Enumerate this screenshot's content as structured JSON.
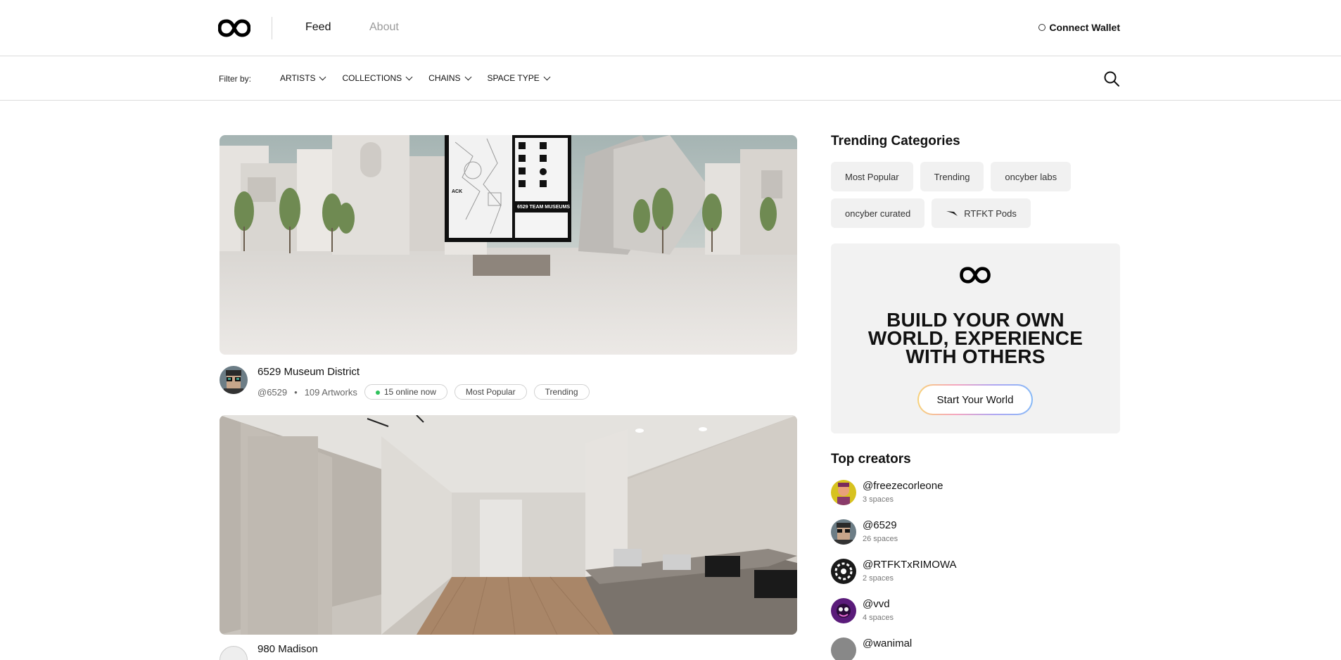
{
  "nav": {
    "feed": "Feed",
    "about": "About",
    "wallet": "Connect Wallet"
  },
  "filter": {
    "label": "Filter by:",
    "items": [
      {
        "label": "ARTISTS"
      },
      {
        "label": "COLLECTIONS"
      },
      {
        "label": "CHAINS"
      },
      {
        "label": "SPACE TYPE"
      }
    ]
  },
  "feed": [
    {
      "title": "6529 Museum District",
      "handle": "@6529",
      "artworks": "109 Artworks",
      "online": "15 online now",
      "tags": [
        "Most Popular",
        "Trending"
      ],
      "billboard_text": "6529 TEAM MUSEUMS",
      "billboard_label": "ACK"
    },
    {
      "title": "980 Madison"
    }
  ],
  "sidebar": {
    "trending_title": "Trending Categories",
    "categories": [
      {
        "label": "Most Popular"
      },
      {
        "label": "Trending"
      },
      {
        "label": "oncyber labs"
      },
      {
        "label": "oncyber curated"
      },
      {
        "label": "RTFKT Pods",
        "icon": "rtfkt-icon"
      }
    ],
    "promo": {
      "heading_line1": "BUILD YOUR OWN",
      "heading_line2": "WORLD, EXPERIENCE",
      "heading_line3": "WITH OTHERS",
      "button": "Start Your World"
    },
    "creators_title": "Top creators",
    "creators": [
      {
        "name": "@freezecorleone",
        "spaces": "3 spaces",
        "color": "#d7c21f"
      },
      {
        "name": "@6529",
        "spaces": "26 spaces",
        "color": "#3c4a52"
      },
      {
        "name": "@RTFKTxRIMOWA",
        "spaces": "2 spaces",
        "color": "#1a1a1a"
      },
      {
        "name": "@vvd",
        "spaces": "4 spaces",
        "color": "#5a1b7a"
      },
      {
        "name": "@wanimal",
        "spaces": "",
        "color": "#888888"
      }
    ]
  },
  "colors": {
    "online": "#2ec25b",
    "accent_text": "#111111",
    "muted": "#9a9a9a"
  }
}
